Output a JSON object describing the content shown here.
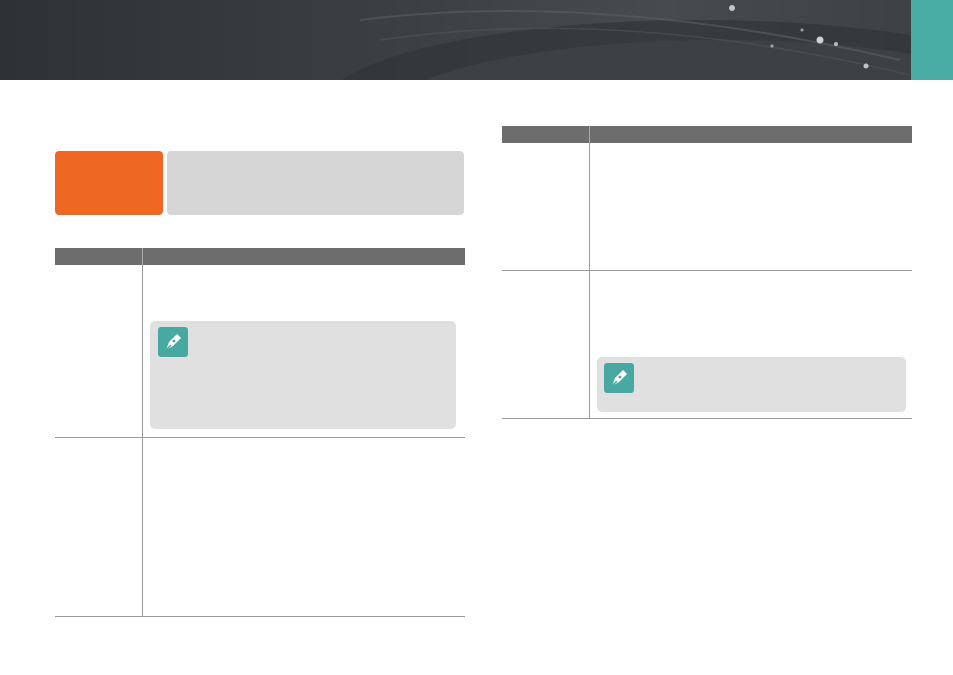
{
  "header": {
    "tab_color": "#4aada5"
  },
  "section_badge": {
    "label": "",
    "color": "#ee6723"
  },
  "section_desc": {
    "text": ""
  },
  "left_table": {
    "columns": [
      "",
      ""
    ],
    "rows": [
      {
        "name": "",
        "desc": "",
        "note": ""
      },
      {
        "name": "",
        "desc": ""
      }
    ]
  },
  "right_table": {
    "columns": [
      "",
      ""
    ],
    "rows": [
      {
        "name": "",
        "desc": ""
      },
      {
        "name": "",
        "desc": "",
        "note": ""
      }
    ]
  },
  "icons": {
    "note": "pen-nib-icon"
  },
  "colors": {
    "accent": "#4aada5",
    "badge": "#ee6723",
    "table_header": "#6d6d6d",
    "note_bg": "#e0e0e0"
  }
}
